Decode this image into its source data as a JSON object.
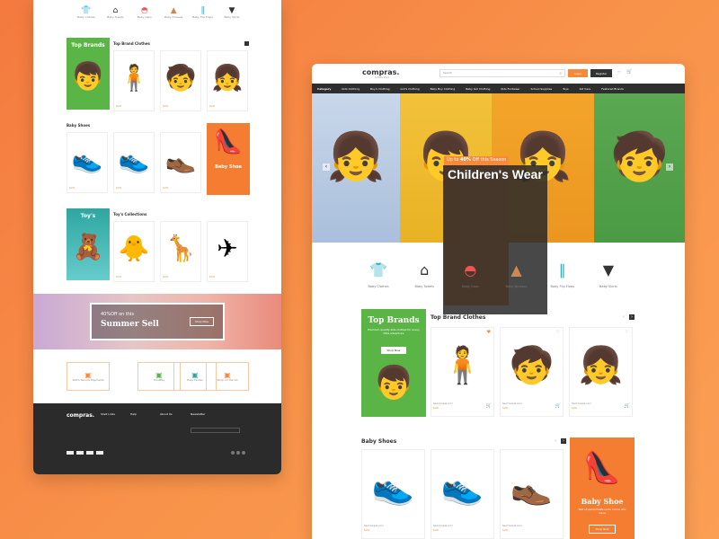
{
  "left": {
    "categories": [
      "Baby Clothes",
      "Baby Towels",
      "Baby Caps",
      "Baby Dresses",
      "Baby Flip Flops",
      "Baby Skirts"
    ],
    "brands": {
      "promo_title": "Top Brands",
      "heading": "Top Brand Clothes",
      "products": [
        {
          "name": "Sed turpis orci",
          "price": "$29"
        },
        {
          "name": "Sed turpis orci",
          "price": "$29"
        },
        {
          "name": "Sed turpis orci",
          "price": "$29"
        },
        {
          "name": "Sed turpis orci",
          "price": "$29"
        }
      ]
    },
    "shoes": {
      "heading": "Baby Shoes",
      "promo_title": "Baby Shoe",
      "products": [
        {
          "name": "Sed turpis orci",
          "price": "$29"
        },
        {
          "name": "Sed turpis orci",
          "price": "$29"
        },
        {
          "name": "Sed turpis orci",
          "price": "$29"
        }
      ]
    },
    "toys": {
      "promo_title": "Toy's",
      "heading": "Toy's Collections",
      "products": [
        {
          "name": "Sed turpis orci",
          "price": "$29"
        },
        {
          "name": "Sed turpis orci",
          "price": "$29"
        },
        {
          "name": "Sed turpis orci",
          "price": "$29"
        }
      ]
    },
    "banner": {
      "line1": "40%Off on this",
      "line2": "Summer Sell",
      "btn": "Shop Now"
    },
    "features": [
      "100% Secure Payments",
      "TrustPay",
      "Help Center",
      "Shop on the Go"
    ],
    "footer": {
      "logo": "compras.",
      "col1": "Shell Links",
      "col2": "Help",
      "col3": "About Us",
      "col4": "Newsletter"
    }
  },
  "right": {
    "logo": "compras.",
    "logo_sub": "clothes store",
    "search_placeholder": "Search",
    "login": "Login",
    "register": "Register",
    "nav": [
      "Category",
      "Kids Clothing",
      "Boy's Clothing",
      "Girl's Clothing",
      "Baby Boy Clothing",
      "Baby Girl Clothing",
      "Kids Footwear",
      "School Supplies",
      "Toys",
      "Kid Care",
      "Featured Brands"
    ],
    "hero": {
      "offer_prefix": "Up to ",
      "offer_pct": "40%",
      "offer_suffix": " Off this Season",
      "title": "Children's Wear"
    },
    "categories": [
      "Baby Clothes",
      "Baby Towels",
      "Baby Caps",
      "Baby Dresses",
      "Baby Flip Flops",
      "Baby Skirts"
    ],
    "brands": {
      "promo_title": "Top Brands",
      "promo_text": "Premium quality kids clothes for every little adventure",
      "promo_btn": "Shop Now",
      "heading": "Top Brand Clothes",
      "products": [
        {
          "name": "Sed turpis orci",
          "price": "$29"
        },
        {
          "name": "Sed turpis orci",
          "price": "$29"
        },
        {
          "name": "Sed turpis orci",
          "price": "$29"
        }
      ]
    },
    "shoes": {
      "heading": "Baby Shoes",
      "promo_title": "Baby Shoe",
      "promo_text": "Sed ut perspiciatis unde omnis iste natus",
      "promo_btn": "Shop Now",
      "products": [
        {
          "name": "Sed turpis orci",
          "price": "$29"
        },
        {
          "name": "Sed turpis orci",
          "price": "$29"
        },
        {
          "name": "Sed turpis orci",
          "price": "$29"
        }
      ]
    }
  }
}
